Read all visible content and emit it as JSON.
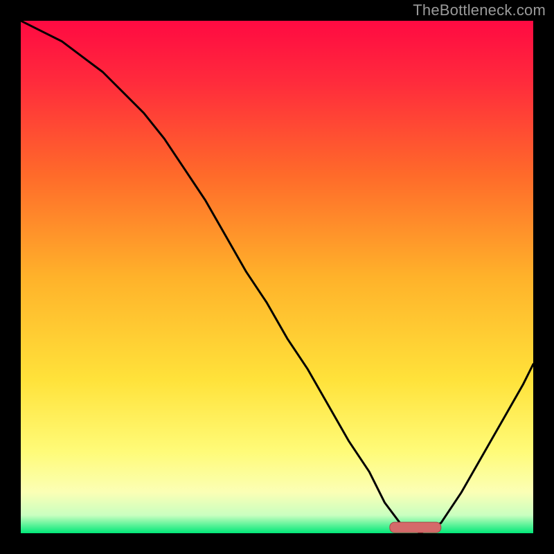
{
  "watermark": "TheBottleneck.com",
  "colors": {
    "bg": "#000000",
    "gradient_stops": [
      {
        "offset": 0.0,
        "color": "#ff0a42"
      },
      {
        "offset": 0.12,
        "color": "#ff2b3c"
      },
      {
        "offset": 0.3,
        "color": "#ff6a2a"
      },
      {
        "offset": 0.5,
        "color": "#ffb22a"
      },
      {
        "offset": 0.7,
        "color": "#ffe23a"
      },
      {
        "offset": 0.84,
        "color": "#fffb78"
      },
      {
        "offset": 0.92,
        "color": "#fbffb5"
      },
      {
        "offset": 0.965,
        "color": "#c9ffc0"
      },
      {
        "offset": 1.0,
        "color": "#00e878"
      }
    ],
    "curve": "#000000",
    "marker_fill": "#d46a6a",
    "marker_stroke": "#a64848"
  },
  "chart_data": {
    "type": "line",
    "title": "",
    "xlabel": "",
    "ylabel": "",
    "xlim": [
      0,
      100
    ],
    "ylim": [
      0,
      100
    ],
    "series": [
      {
        "name": "bottleneck-curve",
        "x": [
          0,
          4,
          8,
          12,
          16,
          20,
          24,
          28,
          32,
          36,
          40,
          44,
          48,
          52,
          56,
          60,
          64,
          68,
          71,
          74,
          78,
          82,
          86,
          90,
          94,
          98,
          100
        ],
        "y": [
          100,
          98,
          96,
          93,
          90,
          86,
          82,
          77,
          71,
          65,
          58,
          51,
          45,
          38,
          32,
          25,
          18,
          12,
          6,
          2,
          0,
          2,
          8,
          15,
          22,
          29,
          33
        ]
      }
    ],
    "marker": {
      "x_start": 72,
      "x_end": 82,
      "y": 1.2
    },
    "annotations": []
  }
}
